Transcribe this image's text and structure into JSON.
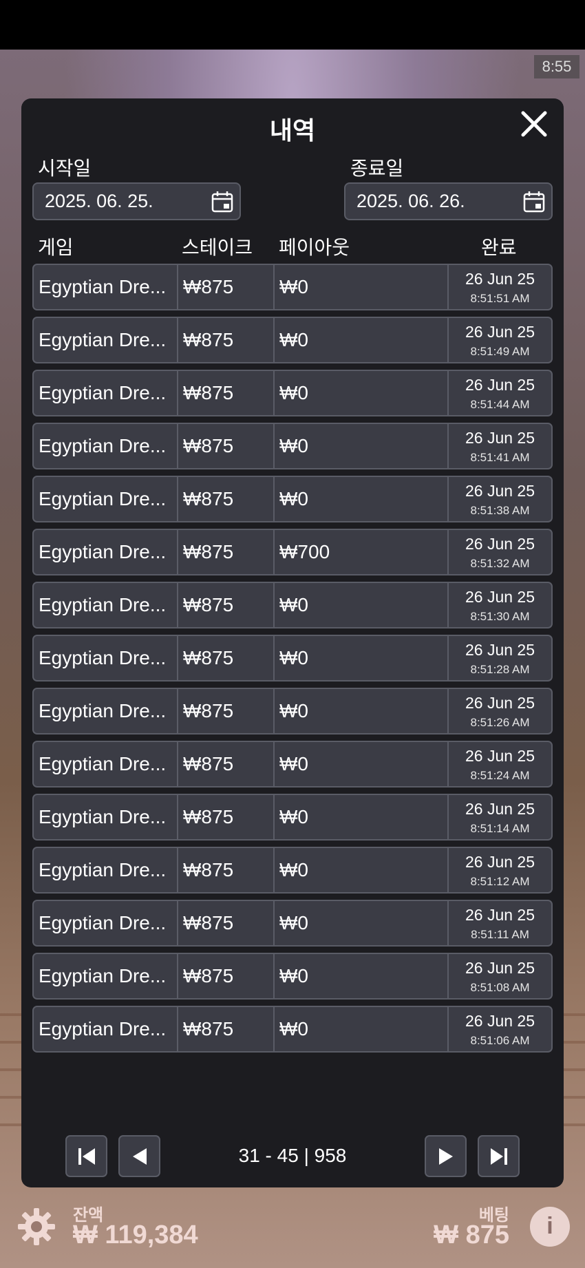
{
  "game": {
    "timer": "8:55"
  },
  "modal": {
    "title": "내역",
    "start_label": "시작일",
    "end_label": "종료일",
    "start_date": "2025. 06. 25.",
    "end_date": "2025. 06. 26.",
    "columns": [
      "게임",
      "스테이크",
      "페이아웃",
      "완료"
    ],
    "rows": [
      {
        "game": "Egyptian Dre...",
        "stake": "₩875",
        "payout": "₩0",
        "date": "26 Jun 25",
        "time": "8:51:51 AM"
      },
      {
        "game": "Egyptian Dre...",
        "stake": "₩875",
        "payout": "₩0",
        "date": "26 Jun 25",
        "time": "8:51:49 AM"
      },
      {
        "game": "Egyptian Dre...",
        "stake": "₩875",
        "payout": "₩0",
        "date": "26 Jun 25",
        "time": "8:51:44 AM"
      },
      {
        "game": "Egyptian Dre...",
        "stake": "₩875",
        "payout": "₩0",
        "date": "26 Jun 25",
        "time": "8:51:41 AM"
      },
      {
        "game": "Egyptian Dre...",
        "stake": "₩875",
        "payout": "₩0",
        "date": "26 Jun 25",
        "time": "8:51:38 AM"
      },
      {
        "game": "Egyptian Dre...",
        "stake": "₩875",
        "payout": "₩700",
        "date": "26 Jun 25",
        "time": "8:51:32 AM"
      },
      {
        "game": "Egyptian Dre...",
        "stake": "₩875",
        "payout": "₩0",
        "date": "26 Jun 25",
        "time": "8:51:30 AM"
      },
      {
        "game": "Egyptian Dre...",
        "stake": "₩875",
        "payout": "₩0",
        "date": "26 Jun 25",
        "time": "8:51:28 AM"
      },
      {
        "game": "Egyptian Dre...",
        "stake": "₩875",
        "payout": "₩0",
        "date": "26 Jun 25",
        "time": "8:51:26 AM"
      },
      {
        "game": "Egyptian Dre...",
        "stake": "₩875",
        "payout": "₩0",
        "date": "26 Jun 25",
        "time": "8:51:24 AM"
      },
      {
        "game": "Egyptian Dre...",
        "stake": "₩875",
        "payout": "₩0",
        "date": "26 Jun 25",
        "time": "8:51:14 AM"
      },
      {
        "game": "Egyptian Dre...",
        "stake": "₩875",
        "payout": "₩0",
        "date": "26 Jun 25",
        "time": "8:51:12 AM"
      },
      {
        "game": "Egyptian Dre...",
        "stake": "₩875",
        "payout": "₩0",
        "date": "26 Jun 25",
        "time": "8:51:11 AM"
      },
      {
        "game": "Egyptian Dre...",
        "stake": "₩875",
        "payout": "₩0",
        "date": "26 Jun 25",
        "time": "8:51:08 AM"
      },
      {
        "game": "Egyptian Dre...",
        "stake": "₩875",
        "payout": "₩0",
        "date": "26 Jun 25",
        "time": "8:51:06 AM"
      }
    ],
    "pagination": "31 - 45 | 958"
  },
  "footer": {
    "balance_label": "잔액",
    "balance_value": "₩ 119,384",
    "bet_label": "베팅",
    "bet_value": "₩ 875",
    "info_glyph": "i"
  },
  "icons": {
    "close": "close-icon",
    "calendar": "calendar-icon",
    "first_page": "first-page-icon",
    "prev_page": "prev-page-icon",
    "next_page": "next-page-icon",
    "last_page": "last-page-icon",
    "settings": "gear-icon",
    "info": "info-icon"
  },
  "colors": {
    "modal_bg": "#1c1c20",
    "row_bg": "#3b3c45",
    "border": "#5a5c66",
    "footer_text": "#f0d9d4"
  }
}
